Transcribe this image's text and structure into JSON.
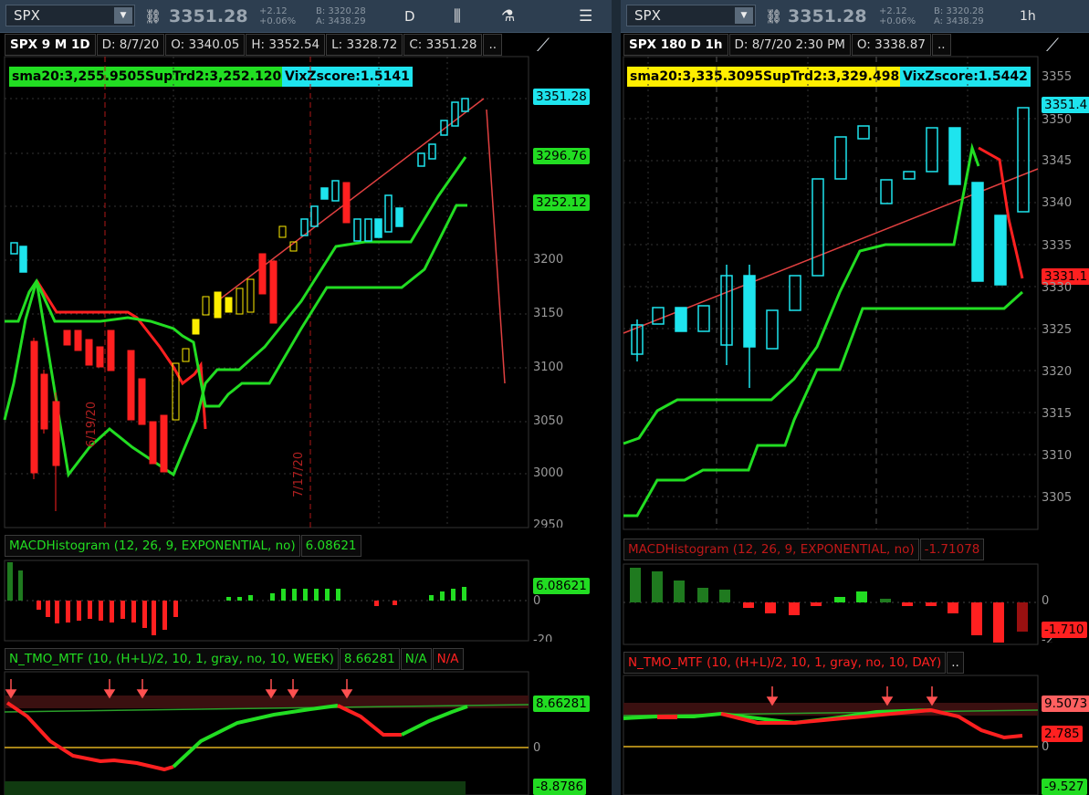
{
  "colors": {
    "green": "#22dd22",
    "red": "#ff2020",
    "cyan": "#1ee4ee",
    "yellow": "#ffee00",
    "grid": "#3a3a3a"
  },
  "left": {
    "toolbar": {
      "symbol": "SPX",
      "last": "3351.28",
      "change": "+2.12",
      "change_pct": "+0.06%",
      "bid": "B: 3320.28",
      "ask": "A: 3438.29",
      "period": "D"
    },
    "header": {
      "title": "SPX 9 M 1D",
      "date": "D: 8/7/20",
      "open": "O: 3340.05",
      "high": "H: 3352.54",
      "low": "L: 3328.72",
      "close": "C: 3351.28",
      "more": ".."
    },
    "bubbles": {
      "sma": "sma20:3,255.9505SupTrd2:3,252.1208",
      "vix": "VixZscore:1.5141"
    },
    "price_tags": {
      "last": "3351.28",
      "t1": "3296.76",
      "t2": "3252.12"
    },
    "axis": [
      "3200",
      "3150",
      "3100",
      "3050",
      "3000",
      "2950"
    ],
    "date_labels": [
      "6/19/20",
      "7/17/20"
    ],
    "macd": {
      "name": "MACDHistogram (12, 26, 9, EXPONENTIAL, no)",
      "value": "6.08621",
      "tag": "6.08621",
      "zero": "0",
      "neg": "-20"
    },
    "tmo": {
      "name": "N_TMO_MTF (10, (H+L)/2, 10, 1, gray, no, 10, WEEK)",
      "value": "8.66281",
      "na1": "N/A",
      "na2": "N/A",
      "tag_top": "8.66281",
      "zero": "0",
      "tag_bottom": "-8.8786"
    }
  },
  "right": {
    "toolbar": {
      "symbol": "SPX",
      "last": "3351.28",
      "change": "+2.12",
      "change_pct": "+0.06%",
      "bid": "B: 3320.28",
      "ask": "A: 3438.29",
      "period": "1h"
    },
    "header": {
      "title": "SPX 180 D 1h",
      "date": "D: 8/7/20 2:30 PM",
      "open": "O: 3338.87",
      "more": ".."
    },
    "bubbles": {
      "sma": "sma20:3,335.3095SupTrd2:3,329.4986",
      "vix": "VixZscore:1.5442"
    },
    "price_tags": {
      "last": "3351.4",
      "red": "3331.1"
    },
    "axis": [
      "3355",
      "3350",
      "3345",
      "3340",
      "3335",
      "3330",
      "3325",
      "3320",
      "3315",
      "3310",
      "3305"
    ],
    "macd": {
      "name": "MACDHistogram (12, 26, 9, EXPONENTIAL, no)",
      "value": "-1.71078",
      "tag": "-1.710",
      "zero": "0",
      "neg": "-2"
    },
    "tmo": {
      "name": "N_TMO_MTF (10, (H+L)/2, 10, 1, gray, no, 10, DAY)",
      "more": "..",
      "tag_top": "9.5073",
      "tag_red": "2.785",
      "zero": "0",
      "tag_bottom": "-9.527"
    }
  }
}
